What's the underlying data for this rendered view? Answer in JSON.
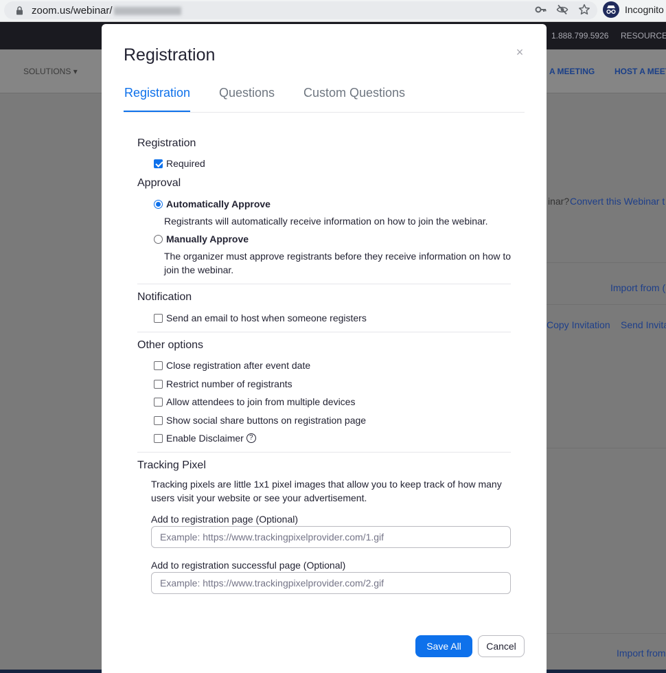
{
  "browser": {
    "url": "zoom.us/webinar/",
    "incognito_label": "Incognito",
    "icons": [
      "lock-icon",
      "key-icon",
      "eye-off-icon",
      "star-icon",
      "incognito-icon"
    ]
  },
  "site": {
    "phone": "1.888.799.5926",
    "resources": "RESOURCES",
    "nav_solutions": "SOLUTIONS",
    "nav_join": "A MEETING",
    "nav_host": "HOST A MEET",
    "webinar_question": "inar?",
    "convert_link": "Convert this Webinar t",
    "import_link_1": "Import from (",
    "copy_invitation": "Copy Invitation",
    "send_invitation": "Send Invita",
    "import_link_2": "Import from"
  },
  "modal": {
    "title": "Registration",
    "close_symbol": "×",
    "tabs": [
      {
        "label": "Registration",
        "active": true
      },
      {
        "label": "Questions",
        "active": false
      },
      {
        "label": "Custom Questions",
        "active": false
      }
    ],
    "registration": {
      "heading": "Registration",
      "required": {
        "label": "Required",
        "checked": true
      }
    },
    "approval": {
      "heading": "Approval",
      "options": [
        {
          "label": "Automatically Approve",
          "selected": true,
          "description": "Registrants will automatically receive information on how to join the webinar."
        },
        {
          "label": "Manually Approve",
          "selected": false,
          "description": "The organizer must approve registrants before they receive information on how to join the webinar."
        }
      ]
    },
    "notification": {
      "heading": "Notification",
      "email_host": {
        "label": "Send an email to host when someone registers",
        "checked": false
      }
    },
    "other_options": {
      "heading": "Other options",
      "items": [
        {
          "label": "Close registration after event date",
          "checked": false
        },
        {
          "label": "Restrict number of registrants",
          "checked": false
        },
        {
          "label": "Allow attendees to join from multiple devices",
          "checked": false
        },
        {
          "label": "Show social share buttons on registration page",
          "checked": false
        },
        {
          "label": "Enable Disclaimer",
          "checked": false
        }
      ],
      "help_symbol": "?"
    },
    "tracking_pixel": {
      "heading": "Tracking Pixel",
      "description": "Tracking pixels are little 1x1 pixel images that allow you to keep track of how many users visit your website or see your advertisement.",
      "registration_page": {
        "label": "Add to registration page (Optional)",
        "value": "",
        "placeholder": "Example: https://www.trackingpixelprovider.com/1.gif"
      },
      "success_page": {
        "label": "Add to registration successful page (Optional)",
        "value": "",
        "placeholder": "Example: https://www.trackingpixelprovider.com/2.gif"
      }
    },
    "buttons": {
      "save": "Save All",
      "cancel": "Cancel"
    },
    "colors": {
      "accent": "#0e71eb",
      "text": "#232333",
      "muted_tab": "#6e7680"
    }
  }
}
